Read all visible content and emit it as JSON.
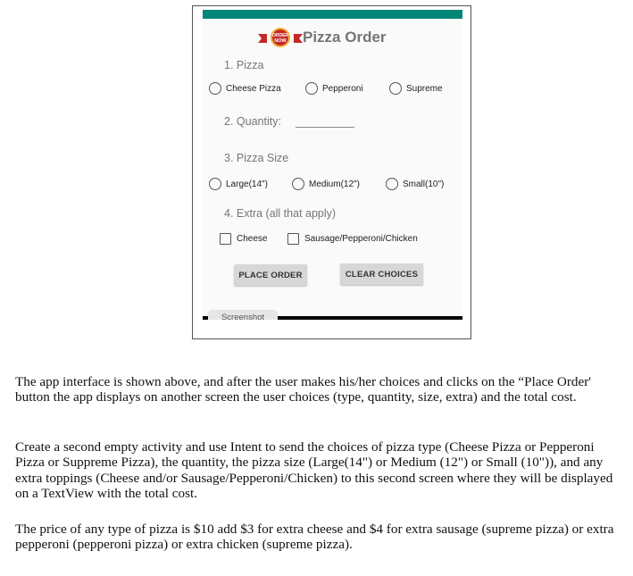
{
  "app": {
    "title": "Pizza Order",
    "logo": {
      "icon": "order-now-badge-icon",
      "line1": "ORDER",
      "line2": "NOW"
    },
    "colors": {
      "status_bar": "#008577",
      "label_gray": "#757575",
      "button_bg": "#d6d7d7"
    }
  },
  "form": {
    "pizza": {
      "label": "1. Pizza",
      "options": [
        {
          "label": "Cheese Pizza",
          "selected": false
        },
        {
          "label": "Pepperoni",
          "selected": false
        },
        {
          "label": "Supreme",
          "selected": false
        }
      ]
    },
    "quantity": {
      "label": "2. Quantity:",
      "value": "",
      "placeholder": ""
    },
    "size": {
      "label": "3. Pizza Size",
      "options": [
        {
          "label": "Large(14\")",
          "selected": false
        },
        {
          "label": "Medium(12\")",
          "selected": false
        },
        {
          "label": "Small(10\")",
          "selected": false
        }
      ]
    },
    "extra": {
      "label": "4. Extra (all that apply)",
      "options": [
        {
          "label": "Cheese",
          "checked": false
        },
        {
          "label": "Sausage/Pepperoni/Chicken",
          "checked": false
        }
      ]
    },
    "buttons": {
      "place_order": "PLACE ORDER",
      "clear_choices": "CLEAR CHOICES"
    }
  },
  "overlay": {
    "screenshot_tab": "Screenshot"
  },
  "document": {
    "paragraphs": [
      "The app interface is shown above, and after the user makes his/her choices and clicks on the “Place Order' button the app displays on another screen the user choices (type, quantity, size, extra) and the total cost.",
      "Create a second empty activity and use Intent to send the choices of pizza type (Cheese Pizza or Pepperoni Pizza or Suppreme Pizza), the quantity, the pizza size (Large(14\") or Medium (12\") or Small (10\")), and any extra toppings (Cheese and/or Sausage/Pepperoni/Chicken) to this second screen where they will be displayed on a TextView with the total cost.",
      "The price of any type of pizza is $10 add $3 for extra cheese and $4 for extra sausage (supreme pizza) or extra pepperoni (pepperoni pizza) or extra chicken (supreme pizza)."
    ]
  }
}
